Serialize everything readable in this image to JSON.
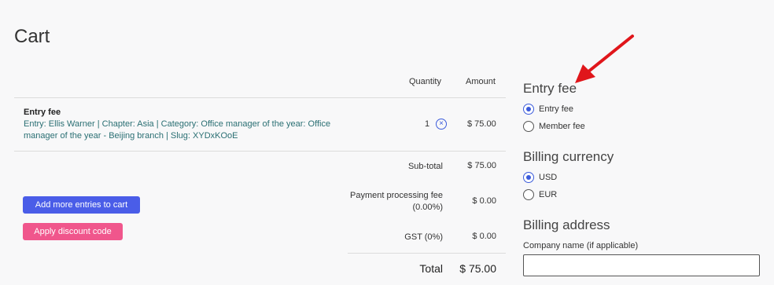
{
  "page": {
    "title": "Cart"
  },
  "table": {
    "headers": {
      "quantity": "Quantity",
      "amount": "Amount"
    },
    "item": {
      "name": "Entry fee",
      "description": "Entry: Ellis Warner | Chapter: Asia | Category: Office manager of the year: Office manager of the year - Beijing branch | Slug: XYDxKOoE",
      "quantity": "1",
      "amount": "$ 75.00"
    },
    "summary": {
      "subtotal_label": "Sub-total",
      "subtotal_value": "$ 75.00",
      "processing_label": "Payment processing fee (0.00%)",
      "processing_value": "$ 0.00",
      "gst_label": "GST (0%)",
      "gst_value": "$ 0.00",
      "total_label": "Total",
      "total_value": "$ 75.00"
    }
  },
  "actions": {
    "add_more": "Add more entries to cart",
    "apply_discount": "Apply discount code"
  },
  "sidebar": {
    "entry_fee": {
      "title": "Entry fee",
      "options": [
        {
          "label": "Entry fee",
          "checked": true
        },
        {
          "label": "Member fee",
          "checked": false
        }
      ]
    },
    "billing_currency": {
      "title": "Billing currency",
      "options": [
        {
          "label": "USD",
          "checked": true
        },
        {
          "label": "EUR",
          "checked": false
        }
      ]
    },
    "billing_address": {
      "title": "Billing address",
      "company_label": "Company name (if applicable)",
      "company_value": ""
    }
  },
  "colors": {
    "primary": "#4a5de8",
    "pink": "#f0568c",
    "link_teal": "#2a6f73",
    "arrow_red": "#e0161b"
  }
}
